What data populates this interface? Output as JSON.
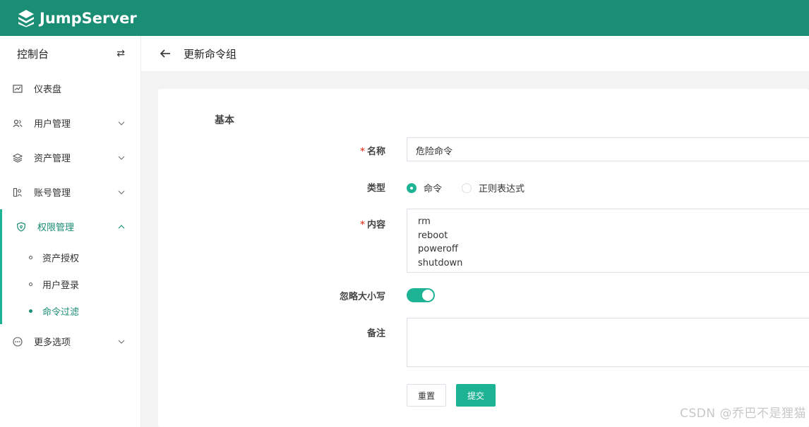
{
  "app": {
    "logo_text": "JumpServer",
    "brand_color": "#1a8d75",
    "accent_color": "#1eb394"
  },
  "sidebar": {
    "console_title": "控制台",
    "switch_icon": "⇄",
    "items": [
      {
        "label": "仪表盘",
        "icon": "dashboard-icon"
      },
      {
        "label": "用户管理",
        "icon": "users-icon"
      },
      {
        "label": "资产管理",
        "icon": "assets-icon"
      },
      {
        "label": "账号管理",
        "icon": "accounts-icon"
      },
      {
        "label": "权限管理",
        "icon": "shield-icon"
      },
      {
        "label": "更多选项",
        "icon": "more-icon"
      }
    ],
    "sub_items": [
      {
        "label": "资产授权"
      },
      {
        "label": "用户登录"
      },
      {
        "label": "命令过滤"
      }
    ]
  },
  "page": {
    "title": "更新命令组"
  },
  "form": {
    "section_title": "基本",
    "name_label": "名称",
    "name_value": "危险命令",
    "type_label": "类型",
    "type_options": [
      "命令",
      "正则表达式"
    ],
    "type_selected": "命令",
    "content_label": "内容",
    "content_lines": [
      "rm",
      "reboot",
      "poweroff",
      "shutdown"
    ],
    "ignore_case_label": "忽略大小写",
    "ignore_case_on": true,
    "note_label": "备注",
    "note_value": "",
    "reset_label": "重置",
    "submit_label": "提交"
  },
  "watermark": "CSDN @乔巴不是狸猫"
}
